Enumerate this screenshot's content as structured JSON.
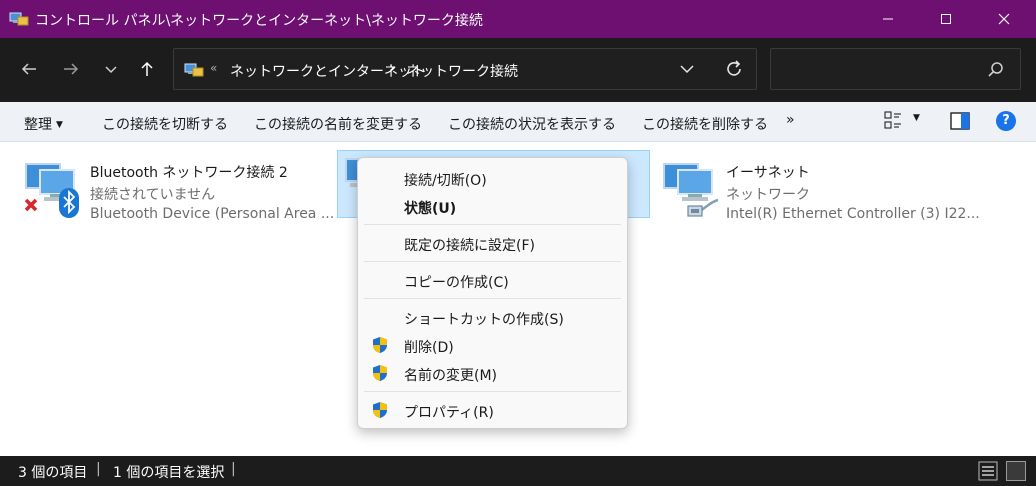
{
  "window": {
    "title": "コントロール パネル\\ネットワークとインターネット\\ネットワーク接続",
    "controls": {
      "minimize": "minimize-icon",
      "maximize": "maximize-icon",
      "close": "close-icon"
    }
  },
  "address": {
    "overflow": "«",
    "crumbs": [
      "ネットワークとインターネット",
      "ネットワーク接続"
    ],
    "separator": "›"
  },
  "search": {
    "placeholder": ""
  },
  "commands": {
    "organize": "整理",
    "disconnect": "この接続を切断する",
    "rename": "この接続の名前を変更する",
    "status": "この接続の状況を表示する",
    "delete": "この接続を削除する",
    "more": "»",
    "help": "?"
  },
  "items": [
    {
      "name": "Bluetooth ネットワーク接続 2",
      "status": "接続されていません",
      "device": "Bluetooth Device (Personal Area ..."
    },
    {
      "name": "",
      "status": "",
      "device": ""
    },
    {
      "name": "イーサネット",
      "status": "ネットワーク",
      "device": "Intel(R) Ethernet Controller (3) I22..."
    }
  ],
  "context_menu": {
    "items": [
      "接続/切断(O)",
      "状態(U)",
      "既定の接続に設定(F)",
      "コピーの作成(C)",
      "ショートカットの作成(S)",
      "削除(D)",
      "名前の変更(M)",
      "プロパティ(R)"
    ]
  },
  "statusbar": {
    "count": "3 個の項目",
    "selected": "1 個の項目を選択",
    "sep": "|"
  },
  "colors": {
    "titlebar": "#6e0f72",
    "navbar": "#1c1c1c",
    "selection": "#cce8ff",
    "accent": "#1a73e8"
  }
}
